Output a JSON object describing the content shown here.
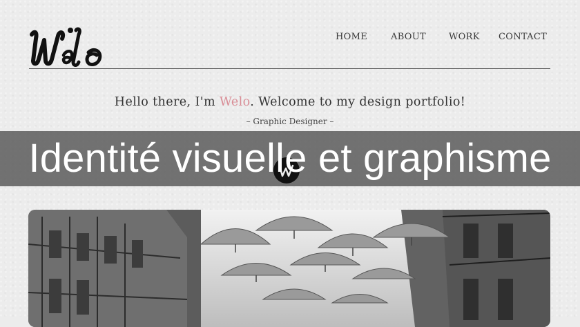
{
  "logo": {
    "text": "Welo",
    "icon": "welo-logo-icon"
  },
  "nav": {
    "items": [
      {
        "label": "HOME"
      },
      {
        "label": "ABOUT"
      },
      {
        "label": "WORK"
      },
      {
        "label": "CONTACT"
      }
    ]
  },
  "intro": {
    "prefix": "Hello there, I'm ",
    "name": "Welo",
    "suffix": ". Welcome to my design portfolio!",
    "role": "– Graphic Designer –"
  },
  "banner": {
    "title": "Identité visuelle et graphisme"
  },
  "colors": {
    "accent": "#d98d96",
    "text": "#333333",
    "banner_bg": "#555555"
  },
  "hero": {
    "image": "black-and-white street with floating umbrellas"
  }
}
